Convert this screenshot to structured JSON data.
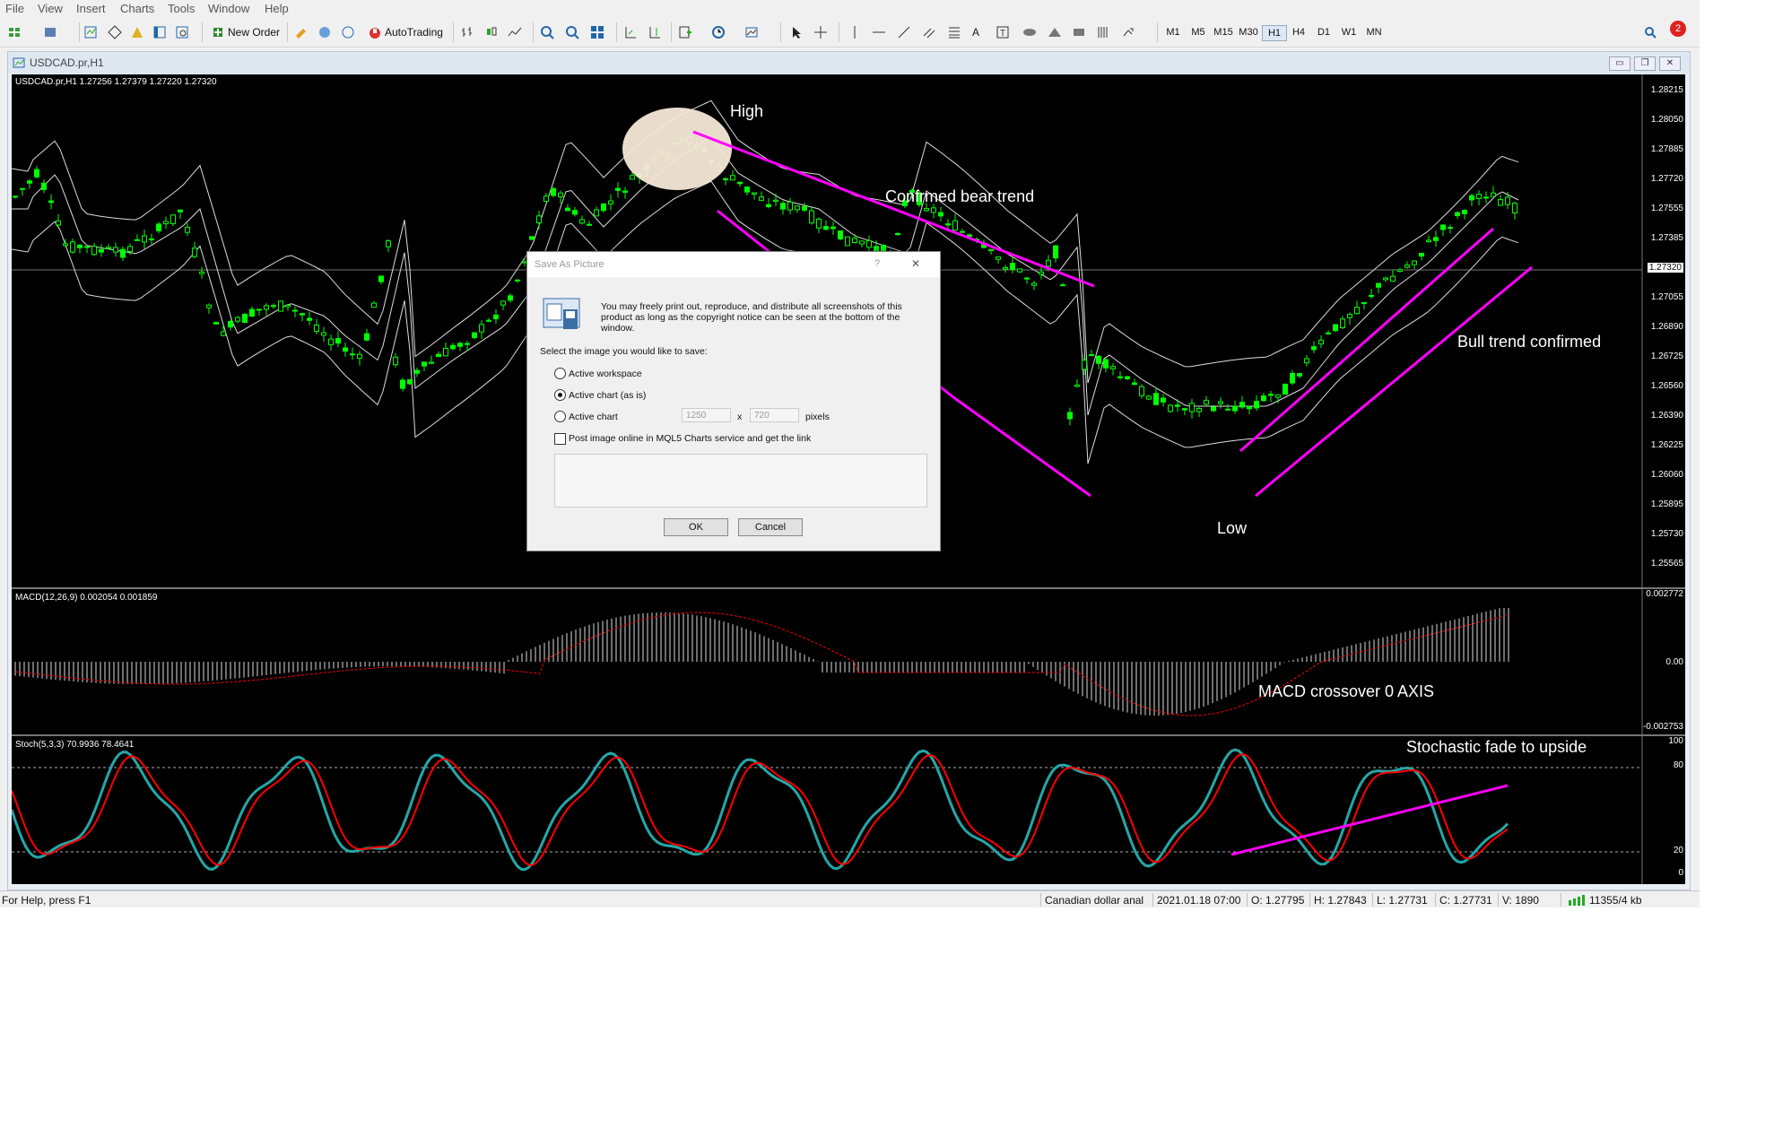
{
  "menu": [
    "File",
    "View",
    "Insert",
    "Charts",
    "Tools",
    "Window",
    "Help"
  ],
  "toolbar": {
    "new_order": "New Order",
    "autotrading": "AutoTrading",
    "timeframes": [
      "M1",
      "M5",
      "M15",
      "M30",
      "H1",
      "H4",
      "D1",
      "W1",
      "MN"
    ],
    "active_timeframe": "H1",
    "notification_count": "2"
  },
  "window": {
    "title": "USDCAD.pr,H1"
  },
  "chart": {
    "header": "USDCAD.pr,H1  1.27256 1.27379 1.27220 1.27320",
    "current_price": "1.27320",
    "price_scale": [
      "1.28215",
      "1.28050",
      "1.27885",
      "1.27720",
      "1.27555",
      "1.27385",
      "1.27220",
      "1.27055",
      "1.26890",
      "1.26725",
      "1.26560",
      "1.26390",
      "1.26225",
      "1.26060",
      "1.25895",
      "1.25730",
      "1.25565"
    ],
    "macd_label": "MACD(12,26,9) 0.002054 0.001859",
    "macd_scale": [
      "0.002772",
      "0.00",
      "-0.002753"
    ],
    "stoch_label": "Stoch(5,3,3) 70.9936 78.4641",
    "stoch_scale": [
      "100",
      "80",
      "20",
      "0"
    ],
    "annotations": {
      "high": "High",
      "bear": "Confrmed bear trend",
      "low": "Low",
      "bull": "Bull trend confirmed",
      "macd": "MACD crossover 0 AXIS",
      "stoch": "Stochastic fade to upside"
    },
    "colors": {
      "bull_candle": "#00ff00",
      "trendline": "#ff00ff",
      "stoch_main": "#26a6a6",
      "stoch_signal": "#ff0000",
      "macd_signal": "#ff0000"
    }
  },
  "dialog": {
    "title": "Save As Picture",
    "help": "?",
    "close": "✕",
    "notice": "You may freely print out, reproduce, and distribute all screenshots of this product as long as the copyright notice can be seen at the bottom of the window.",
    "prompt": "Select the image you would like to save:",
    "options": [
      "Active workspace",
      "Active chart (as is)",
      "Active chart"
    ],
    "selected_option": "Active chart (as is)",
    "width_value": "1250",
    "x_label": "x",
    "height_value": "720",
    "pixels_label": "pixels",
    "post_online": "Post image online in MQL5 Charts service and get the link",
    "ok": "OK",
    "cancel": "Cancel"
  },
  "statusbar": {
    "help": "For Help, press F1",
    "profile": "Canadian dollar anal",
    "datetime": "2021.01.18 07:00",
    "open": "O: 1.27795",
    "high": "H: 1.27843",
    "low": "L: 1.27731",
    "close": "C: 1.27731",
    "volume": "V: 1890",
    "traffic": "11355/4 kb"
  }
}
